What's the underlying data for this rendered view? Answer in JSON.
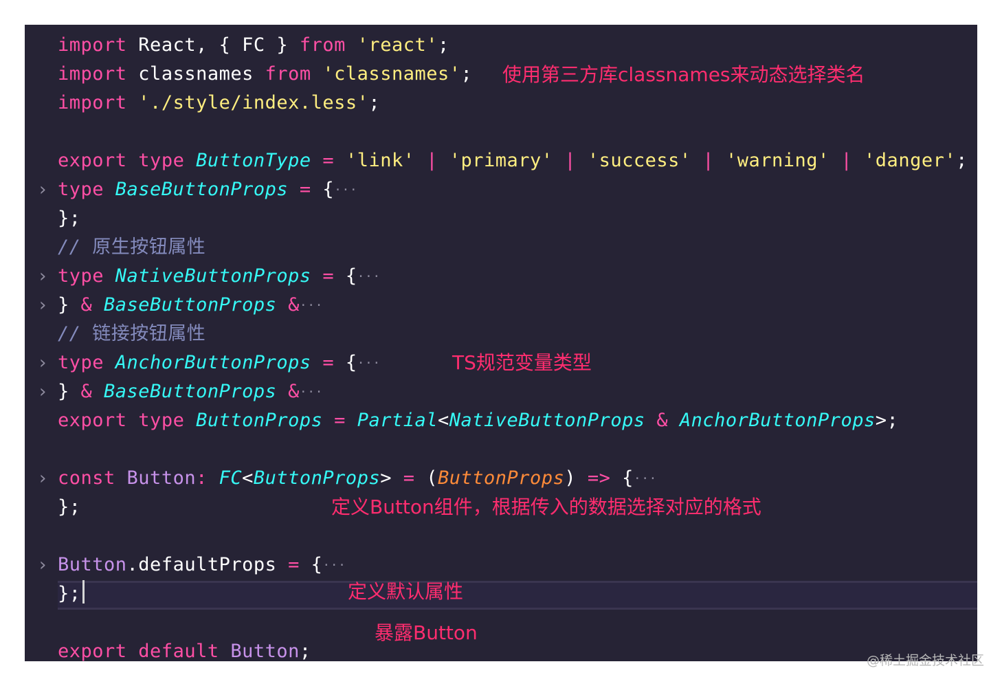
{
  "colors": {
    "background": "#262335",
    "keyword": "#fe4fa5",
    "string": "#ffee80",
    "type": "#36f9f6",
    "comment": "#848bbd",
    "annotation": "#ff2d6f"
  },
  "icons": {
    "fold": "chevron-right-icon"
  },
  "code": {
    "l1": {
      "k1": "import",
      "t1": " React, { FC } ",
      "k2": "from",
      "s1": " 'react'",
      "p": ";"
    },
    "l2": {
      "k1": "import",
      "t1": " classnames ",
      "k2": "from",
      "s1": " 'classnames'",
      "p": ";"
    },
    "l3": {
      "k1": "import",
      "s1": " './style/index.less'",
      "p": ";"
    },
    "l5": {
      "k1": "export",
      "k2": " type ",
      "t1": "ButtonType",
      "o1": " = ",
      "s1": "'link'",
      "o2": " | ",
      "s2": "'primary'",
      "o3": " | ",
      "s3": "'success'",
      "o4": " | ",
      "s4": "'warning'",
      "o5": " | ",
      "s5": "'danger'",
      "p": ";"
    },
    "l6": {
      "k1": "type ",
      "t1": "BaseButtonProps",
      "o1": " = ",
      "p": "{"
    },
    "l7": {
      "p": "};"
    },
    "l8": {
      "c1": "// ",
      "c2": "原生按钮属性"
    },
    "l9": {
      "k1": "type ",
      "t1": "NativeButtonProps",
      "o1": " = ",
      "p": "{"
    },
    "l10": {
      "p": "} ",
      "o1": "& ",
      "t1": "BaseButtonProps",
      "o2": " &"
    },
    "l11": {
      "c1": "// ",
      "c2": "链接按钮属性"
    },
    "l12": {
      "k1": "type ",
      "t1": "AnchorButtonProps",
      "o1": " = ",
      "p": "{"
    },
    "l13": {
      "p": "} ",
      "o1": "& ",
      "t1": "BaseButtonProps",
      "o2": " &"
    },
    "l14": {
      "k1": "export",
      "k2": " type ",
      "t1": "ButtonProps",
      "o1": " = ",
      "t2": "Partial",
      "p1": "<",
      "t3": "NativeButtonProps",
      "o2": " & ",
      "t4": "AnchorButtonProps",
      "p2": ">;"
    },
    "l16": {
      "k1": "const ",
      "i1": "Button",
      "o1": ": ",
      "t1": "FC",
      "p1": "<",
      "t2": "ButtonProps",
      "p2": ">",
      "o2": " = ",
      "p3": "(",
      "a1": "ButtonProps",
      "p4": ") ",
      "o3": "=>",
      "p5": " {"
    },
    "l17": {
      "p": "};"
    },
    "l19": {
      "i1": "Button",
      "t1": ".defaultProps",
      "o1": " = ",
      "p": "{"
    },
    "l20": {
      "p": "};"
    },
    "l22": {
      "k1": "export",
      "k2": " default ",
      "i1": "Button",
      "p": ";"
    }
  },
  "annotations": {
    "classnames": "使用第三方库classnames来动态选择类名",
    "ts_types": "TS规范变量类型",
    "define_button": "定义Button组件，根据传入的数据选择对应的格式",
    "default_props": "定义默认属性",
    "export_button": "暴露Button"
  },
  "watermark": "@稀土掘金技术社区"
}
